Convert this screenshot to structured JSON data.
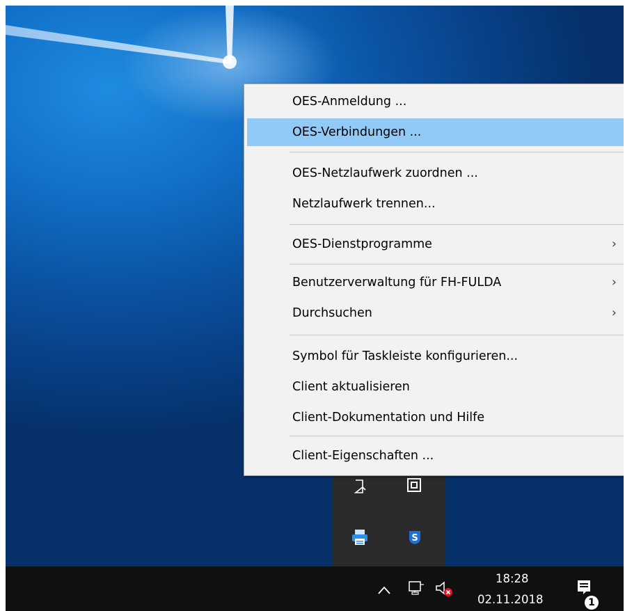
{
  "context_menu": {
    "items": [
      {
        "label": "OES-Anmeldung ...",
        "highlighted": false
      },
      {
        "label": "OES-Verbindungen ...",
        "highlighted": true
      },
      {
        "label": "OES-Netzlaufwerk zuordnen ...",
        "highlighted": false
      },
      {
        "label": "Netzlaufwerk trennen...",
        "highlighted": false
      },
      {
        "label": "OES-Dienstprogramme",
        "highlighted": false,
        "submenu": true
      },
      {
        "label": "Benutzerverwaltung für FH-FULDA",
        "highlighted": false,
        "submenu": true
      },
      {
        "label": "Durchsuchen",
        "highlighted": false,
        "submenu": true
      },
      {
        "label": "Symbol für Taskleiste konfigurieren...",
        "highlighted": false
      },
      {
        "label": "Client aktualisieren",
        "highlighted": false
      },
      {
        "label": "Client-Dokumentation und Hilfe",
        "highlighted": false
      },
      {
        "label": "Client-Eigenschaften ...",
        "highlighted": false
      }
    ],
    "submenu_glyph": "›",
    "highlight_color": "#91c9f7"
  },
  "tray_overflow": {
    "icons": [
      "usb-eject-icon",
      "window-app-icon",
      "printer-icon",
      "security-shield-icon"
    ],
    "shield_letter": "S"
  },
  "taskbar": {
    "time": "18:28",
    "date": "02.11.2018",
    "notification_count": "1",
    "icons": [
      "chevron-up-icon",
      "network-icon",
      "volume-muted-icon",
      "action-center-icon"
    ]
  }
}
